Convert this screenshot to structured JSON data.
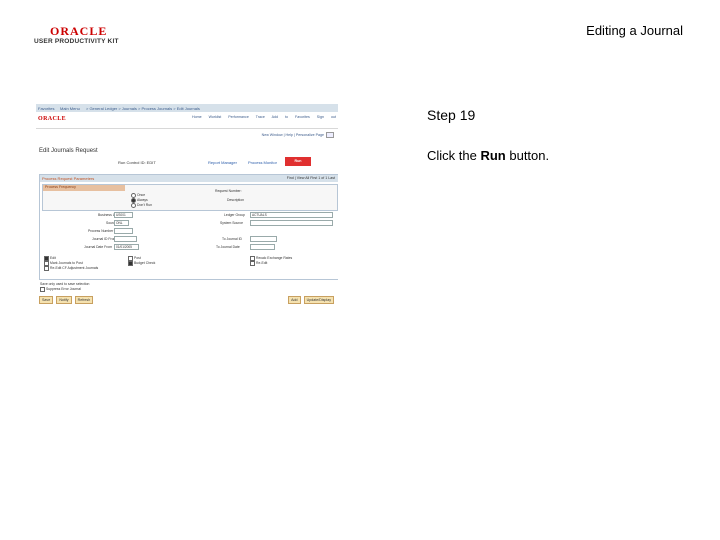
{
  "header": {
    "oracle_logo": "ORACLE",
    "upk_logo": "USER PRODUCTIVITY KIT",
    "document_title": "Editing a Journal"
  },
  "step": {
    "title": "Step 19",
    "instruction_prefix": "Click the ",
    "instruction_bold": "Run",
    "instruction_suffix": " button."
  },
  "screenshot": {
    "breadcrumb_1": "Favorites",
    "breadcrumb_2": "Main Menu",
    "breadcrumb_3": "> General Ledger > Journals > Process Journals > Edit Journals",
    "oracle": "ORACLE",
    "nav_links": "Home   Worklist   Performance Trace   Add to Favorites   Sign out",
    "new_window": "New Window | Help | Personalize Page",
    "page_title": "Edit Journals Request",
    "run_control_label": "Run Control ID: EDIT",
    "report_manager": "Report Manager",
    "process_monitor": "Process Monitor",
    "run_button": "Run",
    "panel_title": "Process Request Parameters",
    "panel_nav": "Find | View All    First  1 of 1  Last",
    "subpanel_title": "Process Frequency",
    "freq_once": "Once",
    "freq_always": "Always",
    "freq_dont_run": "Don't Run",
    "request_number": "Request Number:",
    "request_desc": "Description",
    "business_unit": "Business Unit",
    "business_unit_val": "US001",
    "source": "Source",
    "source_val": "ONL",
    "process_number": "Process Number ID",
    "journal_id_from": "Journal ID From",
    "journal_date_from": "Journal Date From",
    "journal_date_val": "01/01/2005",
    "ledger_group": "Ledger Group",
    "ledger_group_val": "ACTUALS",
    "system_source": "System Source",
    "to_journal_id": "To Journal ID",
    "to_journal_date": "To Journal Date",
    "chk_edit": "Edit",
    "chk_post": "Post",
    "chk_recalc": "Recalc Exchange Rates",
    "chk_mark_post": "Mark Journals to Post",
    "chk_budget": "Budget Check",
    "chk_reedit": "Re-Edit",
    "chk_adjust": "Re-Edit CF Adjustment Journals",
    "note": "Save only used to save selection",
    "note_chk": "Suppress Error Journal",
    "btn_save": "Save",
    "btn_notify": "Notify",
    "btn_refresh": "Refresh",
    "btn_add": "Add",
    "btn_update": "Update/Display"
  },
  "colors": {
    "oracle_red": "#cc0000",
    "run_button": "#e03030",
    "link_blue": "#2a5caa"
  }
}
